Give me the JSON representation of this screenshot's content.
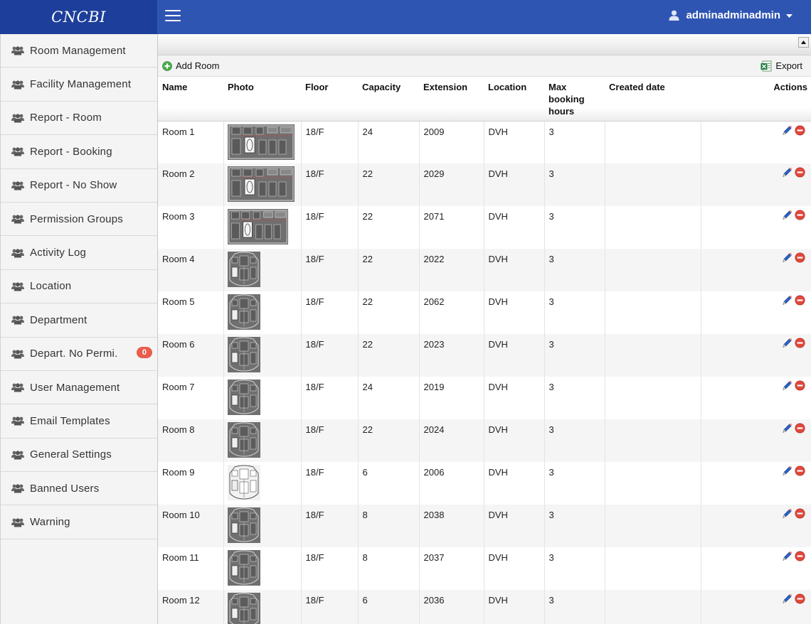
{
  "brand": "CNCBI",
  "header": {
    "username": "adminadminadmin"
  },
  "sidebar": {
    "items": [
      {
        "label": "Room Management"
      },
      {
        "label": "Facility Management"
      },
      {
        "label": "Report - Room"
      },
      {
        "label": "Report - Booking"
      },
      {
        "label": "Report - No Show"
      },
      {
        "label": "Permission Groups"
      },
      {
        "label": "Activity Log"
      },
      {
        "label": "Location"
      },
      {
        "label": "Department"
      },
      {
        "label": "Depart. No Permi.",
        "badge": "0"
      },
      {
        "label": "User Management"
      },
      {
        "label": "Email Templates"
      },
      {
        "label": "General Settings"
      },
      {
        "label": "Banned Users"
      },
      {
        "label": "Warning"
      }
    ]
  },
  "toolbar": {
    "add_label": "Add Room",
    "export_label": "Export"
  },
  "table": {
    "columns": {
      "name": "Name",
      "photo": "Photo",
      "floor": "Floor",
      "capacity": "Capacity",
      "extension": "Extension",
      "location": "Location",
      "max_hours": "Max booking hours",
      "created": "Created date",
      "actions": "Actions"
    },
    "rows": [
      {
        "name": "Room 1",
        "floor": "18/F",
        "capacity": "24",
        "extension": "2009",
        "location": "DVH",
        "max_hours": "3",
        "created": "",
        "thumb": "wide"
      },
      {
        "name": "Room 2",
        "floor": "18/F",
        "capacity": "22",
        "extension": "2029",
        "location": "DVH",
        "max_hours": "3",
        "created": "",
        "thumb": "wide"
      },
      {
        "name": "Room 3",
        "floor": "18/F",
        "capacity": "22",
        "extension": "2071",
        "location": "DVH",
        "max_hours": "3",
        "created": "",
        "thumb": "medium"
      },
      {
        "name": "Room 4",
        "floor": "18/F",
        "capacity": "22",
        "extension": "2022",
        "location": "DVH",
        "max_hours": "3",
        "created": "",
        "thumb": "narrow"
      },
      {
        "name": "Room 5",
        "floor": "18/F",
        "capacity": "22",
        "extension": "2062",
        "location": "DVH",
        "max_hours": "3",
        "created": "",
        "thumb": "narrow"
      },
      {
        "name": "Room 6",
        "floor": "18/F",
        "capacity": "22",
        "extension": "2023",
        "location": "DVH",
        "max_hours": "3",
        "created": "",
        "thumb": "narrow"
      },
      {
        "name": "Room 7",
        "floor": "18/F",
        "capacity": "24",
        "extension": "2019",
        "location": "DVH",
        "max_hours": "3",
        "created": "",
        "thumb": "narrow"
      },
      {
        "name": "Room 8",
        "floor": "18/F",
        "capacity": "22",
        "extension": "2024",
        "location": "DVH",
        "max_hours": "3",
        "created": "",
        "thumb": "narrow"
      },
      {
        "name": "Room 9",
        "floor": "18/F",
        "capacity": "6",
        "extension": "2006",
        "location": "DVH",
        "max_hours": "3",
        "created": "",
        "thumb": "light"
      },
      {
        "name": "Room 10",
        "floor": "18/F",
        "capacity": "8",
        "extension": "2038",
        "location": "DVH",
        "max_hours": "3",
        "created": "",
        "thumb": "narrow"
      },
      {
        "name": "Room 11",
        "floor": "18/F",
        "capacity": "8",
        "extension": "2037",
        "location": "DVH",
        "max_hours": "3",
        "created": "",
        "thumb": "narrow"
      },
      {
        "name": "Room 12",
        "floor": "18/F",
        "capacity": "6",
        "extension": "2036",
        "location": "DVH",
        "max_hours": "3",
        "created": "",
        "thumb": "narrow"
      }
    ]
  },
  "colors": {
    "header_bg": "#2f55b3",
    "brand_bg": "#1d3f9b",
    "badge": "#e95c4e",
    "delete": "#e0493d",
    "edit": "#2a62c9"
  }
}
